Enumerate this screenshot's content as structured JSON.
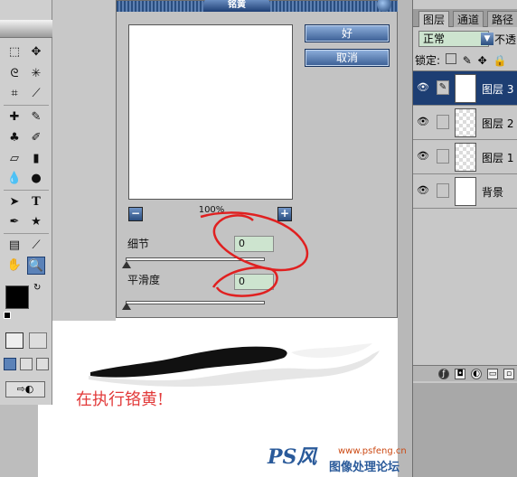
{
  "dialog": {
    "title": "铭黄",
    "ok_label": "好",
    "cancel_label": "取消",
    "zoom_value": "100%",
    "zoom_out_symbol": "−",
    "zoom_in_symbol": "+",
    "detail_label": "细节",
    "detail_value": "0",
    "smooth_label": "平滑度",
    "smooth_value": "0",
    "detail_slider": 0,
    "smooth_slider": 0
  },
  "layers_panel": {
    "tabs": [
      "图层",
      "通道",
      "路径"
    ],
    "blend_mode": "正常",
    "opacity_label": "不透",
    "lock_label": "锁定:",
    "layers": [
      {
        "name": "图层 3",
        "selected": true
      },
      {
        "name": "图层 2",
        "selected": false
      },
      {
        "name": "图层 1",
        "selected": false
      },
      {
        "name": "背景",
        "selected": false
      }
    ]
  },
  "toolbox": {
    "icons": [
      "marquee-icon",
      "move-icon",
      "lasso-icon",
      "magic-wand-icon",
      "crop-icon",
      "slice-icon",
      "healing-icon",
      "brush-icon",
      "stamp-icon",
      "history-brush-icon",
      "eraser-icon",
      "gradient-icon",
      "blur-icon",
      "dodge-icon",
      "path-select-icon",
      "type-icon",
      "pen-icon",
      "shape-icon",
      "notes-icon",
      "eyedropper-icon",
      "hand-icon",
      "zoom-icon"
    ],
    "foreground_color": "#000000",
    "background_color": "#ffffff"
  },
  "image": {
    "caption": "在执行铬黄!",
    "watermark_logo": "PS风",
    "watermark_url": "www.psfeng.cn",
    "watermark_text": "图像处理论坛"
  },
  "colors": {
    "dialog_button": "#3a5e94",
    "selected_layer": "#1d3e73",
    "caption": "#e23a3a",
    "annotation": "#e02020"
  }
}
